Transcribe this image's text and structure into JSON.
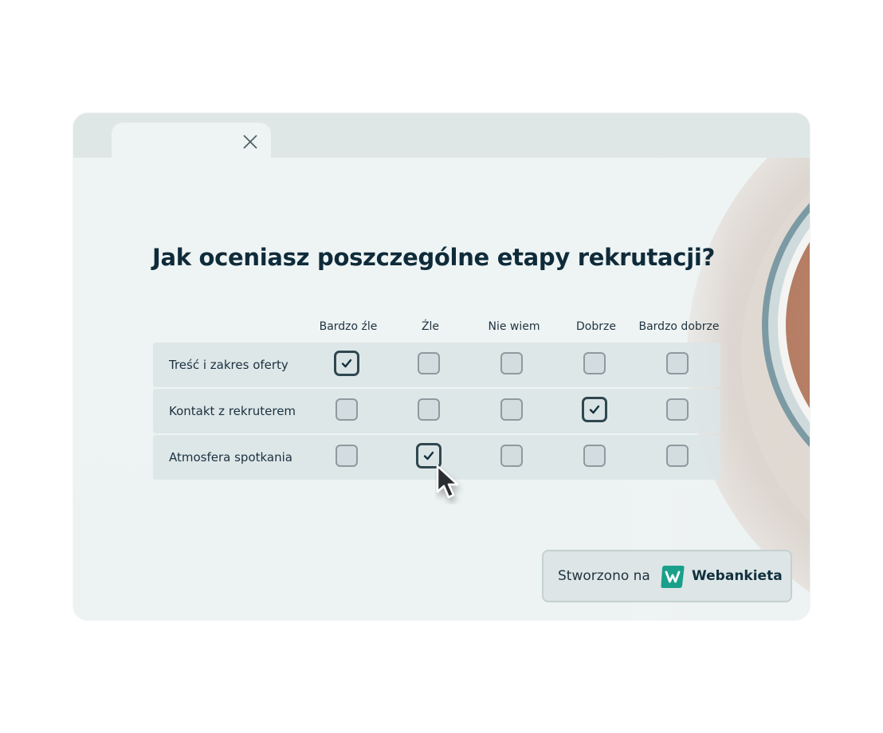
{
  "survey": {
    "question": "Jak oceniasz poszczególne etapy rekrutacji?",
    "columns": [
      "Bardzo źle",
      "Źle",
      "Nie wiem",
      "Dobrze",
      "Bardzo dobrze"
    ],
    "rows": [
      {
        "label": "Treść i zakres oferty",
        "selected": 0
      },
      {
        "label": "Kontakt z rekruterem",
        "selected": 3
      },
      {
        "label": "Atmosfera spotkania",
        "selected": 1
      }
    ]
  },
  "badge": {
    "prefix": "Stworzono na",
    "brand": "Webankieta"
  },
  "icons": {
    "tab_close": "close-icon",
    "checkmark": "checkmark-icon",
    "pointer": "mouse-pointer-icon",
    "logo": "webankieta-logo-icon"
  },
  "colors": {
    "title": "#0f2b3a",
    "checked_border": "#2f474f",
    "brand_green": "#1aa08a"
  }
}
